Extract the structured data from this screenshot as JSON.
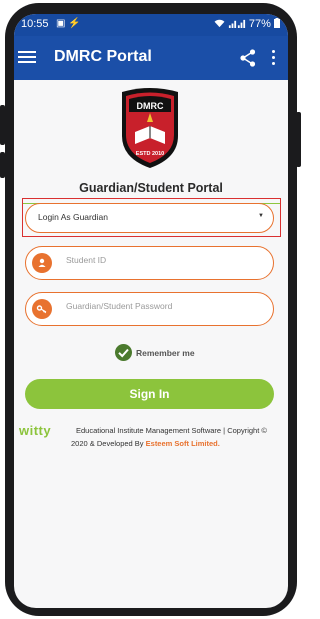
{
  "status_bar": {
    "time": "10:55",
    "left_icons": "▣ ⚡",
    "right_text": "77%"
  },
  "app_bar": {
    "title": "DMRC Portal"
  },
  "logo": {
    "name": "DMRC",
    "estd": "ESTD 2010"
  },
  "portal": {
    "title": "Guardian/Student Portal"
  },
  "form": {
    "login_type": "Login As Guardian",
    "student_id_placeholder": "Student ID",
    "password_placeholder": "Guardian/Student Password",
    "remember_label": "Remember me",
    "signin_label": "Sign In"
  },
  "footer": {
    "brand": "witty",
    "line1": "Educational Institute Management Software | Copyright ©",
    "line2_prefix": "2020 & Developed By ",
    "company": "Esteem Soft Limited."
  },
  "colors": {
    "appbar": "#1b4fa8",
    "statusbar": "#174aa1",
    "accent_orange": "#e8722f",
    "accent_green": "#8cc43c",
    "highlight_red": "#d93030"
  }
}
